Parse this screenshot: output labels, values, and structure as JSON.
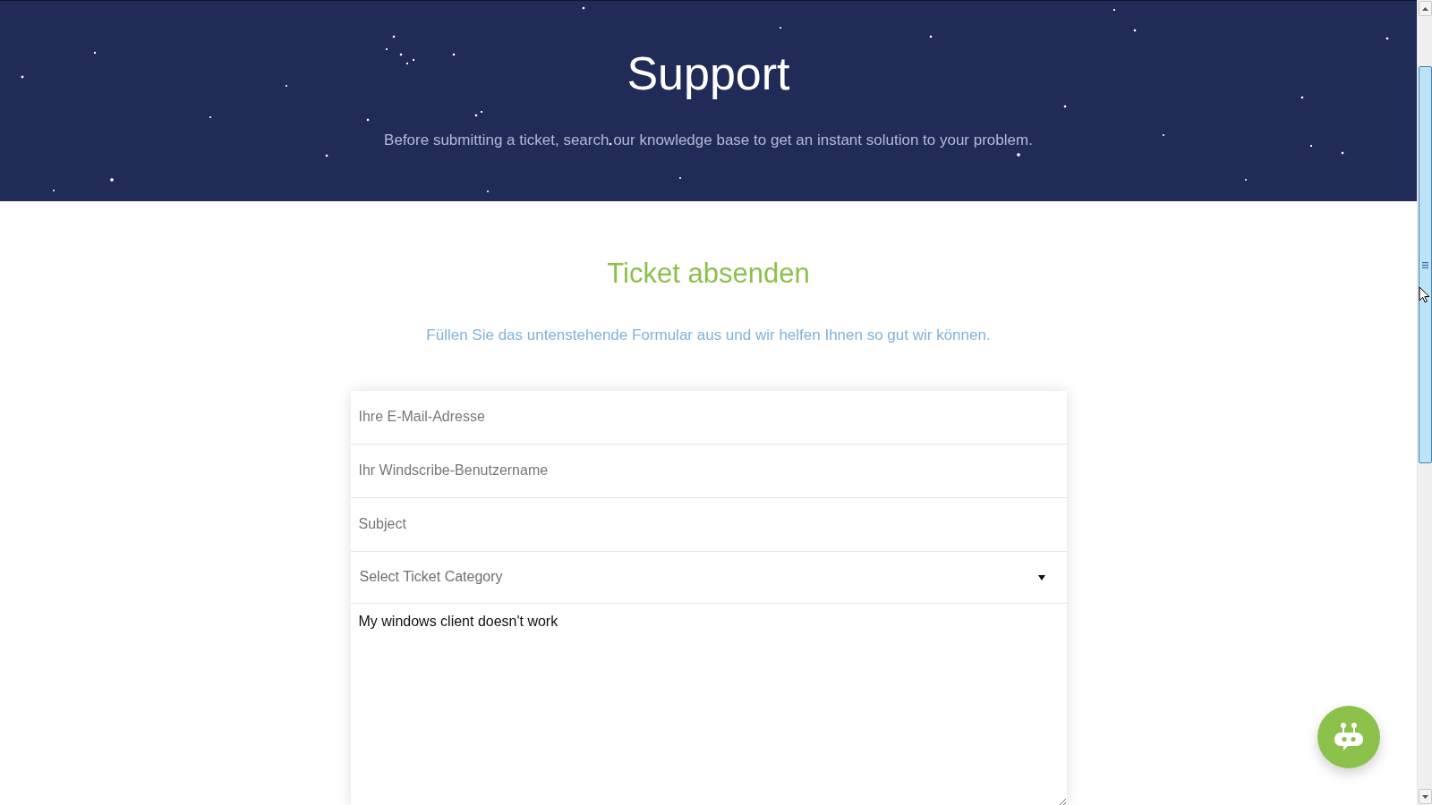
{
  "header": {
    "title": "Support",
    "subtitle": "Before submitting a ticket, search our knowledge base to get an instant solution to your problem."
  },
  "ticket_section": {
    "title": "Ticket absenden",
    "intro": "Füllen Sie das untenstehende Formular aus und wir helfen Ihnen so gut wir können."
  },
  "form": {
    "fields": [
      {
        "kind": "input",
        "placeholder": "Ihre E-Mail-Adresse"
      },
      {
        "kind": "input",
        "placeholder": "Ihr Windscribe-Benutzername"
      },
      {
        "kind": "input",
        "placeholder": "Subject"
      },
      {
        "kind": "select",
        "placeholder": "Select Ticket Category"
      },
      {
        "kind": "textarea",
        "value": "My windows client doesn't work"
      }
    ]
  }
}
